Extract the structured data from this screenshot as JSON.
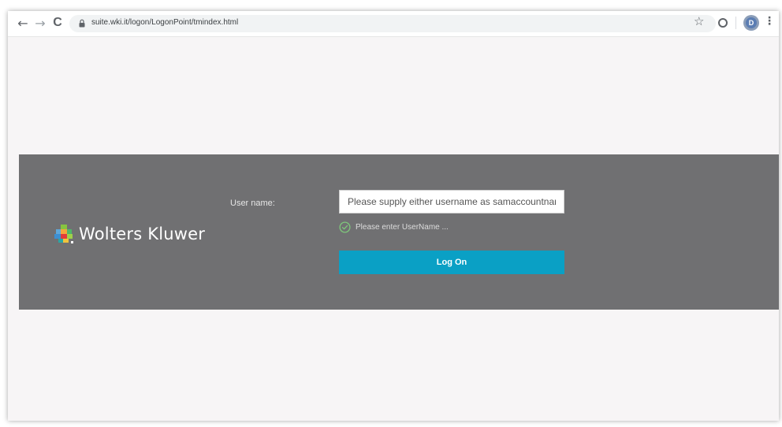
{
  "browser": {
    "url": "suite.wki.it/logon/LogonPoint/tmindex.html",
    "back_glyph": "←",
    "forward_glyph": "→",
    "reload_glyph": "C",
    "bookmark_glyph": "☆",
    "profile_initial": "D",
    "menu_glyph": "⋮",
    "icons": [
      "back-arrow-icon",
      "forward-arrow-icon",
      "reload-icon",
      "lock-icon",
      "bookmark-star-icon",
      "extension-icon",
      "profile-avatar",
      "more-menu-icon"
    ]
  },
  "brand": {
    "name": "Wolters Kluwer",
    "colors": {
      "banner": "#707072",
      "accent": "#0aa0c5",
      "success": "#7ec77b"
    }
  },
  "login": {
    "username_label": "User name:",
    "username_placeholder": "Please supply either username as samaccountname",
    "username_value": "",
    "hint_text": "Please enter UserName ...",
    "hint_icon": "check-circle-icon",
    "logon_button": "Log On"
  }
}
